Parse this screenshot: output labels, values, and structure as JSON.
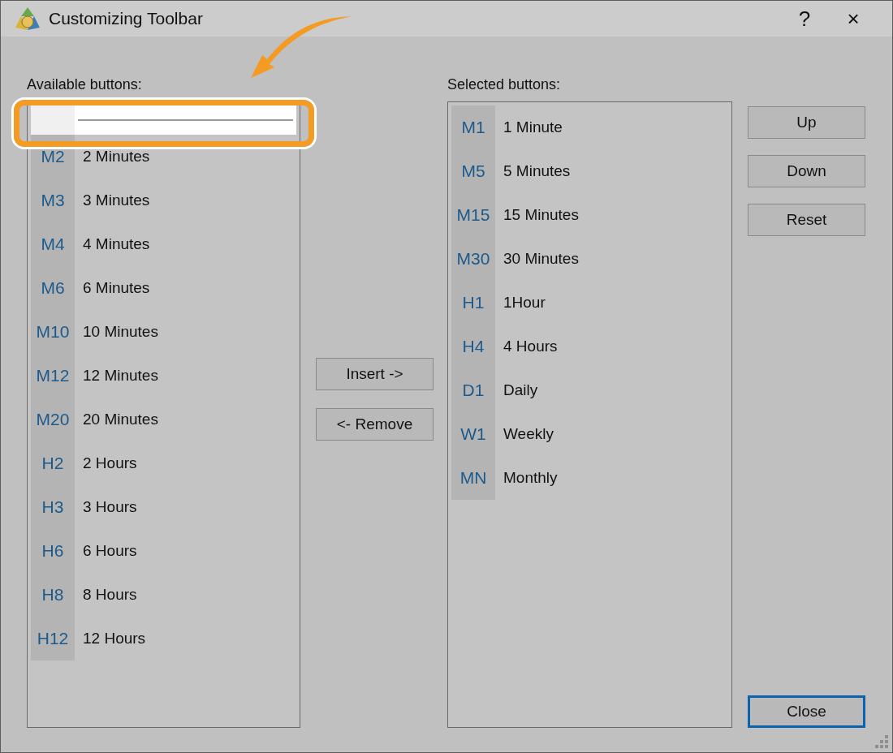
{
  "window": {
    "title": "Customizing Toolbar",
    "help": "?",
    "close": "×"
  },
  "available": {
    "label": "Available buttons:",
    "items": [
      {
        "kind": "separator",
        "selected": true
      },
      {
        "kind": "button",
        "code": "M2",
        "name": "2 Minutes",
        "selected": false
      },
      {
        "kind": "button",
        "code": "M3",
        "name": "3 Minutes",
        "selected": false
      },
      {
        "kind": "button",
        "code": "M4",
        "name": "4 Minutes",
        "selected": false
      },
      {
        "kind": "button",
        "code": "M6",
        "name": "6 Minutes",
        "selected": false
      },
      {
        "kind": "button",
        "code": "M10",
        "name": "10 Minutes",
        "selected": false
      },
      {
        "kind": "button",
        "code": "M12",
        "name": "12 Minutes",
        "selected": false
      },
      {
        "kind": "button",
        "code": "M20",
        "name": "20 Minutes",
        "selected": false
      },
      {
        "kind": "button",
        "code": "H2",
        "name": "2 Hours",
        "selected": false
      },
      {
        "kind": "button",
        "code": "H3",
        "name": "3 Hours",
        "selected": false
      },
      {
        "kind": "button",
        "code": "H6",
        "name": "6 Hours",
        "selected": false
      },
      {
        "kind": "button",
        "code": "H8",
        "name": "8 Hours",
        "selected": false
      },
      {
        "kind": "button",
        "code": "H12",
        "name": "12 Hours",
        "selected": false
      }
    ]
  },
  "middle_buttons": [
    "Insert ->",
    "<- Remove"
  ],
  "selected": {
    "label": "Selected buttons:",
    "items": [
      {
        "code": "M1",
        "name": "1 Minute",
        "selected": false
      },
      {
        "code": "M5",
        "name": "5 Minutes",
        "selected": false
      },
      {
        "code": "M15",
        "name": "15 Minutes",
        "selected": false
      },
      {
        "code": "M30",
        "name": "30 Minutes",
        "selected": false
      },
      {
        "code": "H1",
        "name": "1Hour",
        "selected": false
      },
      {
        "code": "H4",
        "name": "4 Hours",
        "selected": false
      },
      {
        "code": "D1",
        "name": "Daily",
        "selected": false
      },
      {
        "code": "W1",
        "name": "Weekly",
        "selected": false
      },
      {
        "code": "MN",
        "name": "Monthly",
        "selected": false
      }
    ]
  },
  "side_buttons": [
    "Up",
    "Down",
    "Reset"
  ],
  "close_button": {
    "label": "Close",
    "default": true
  }
}
